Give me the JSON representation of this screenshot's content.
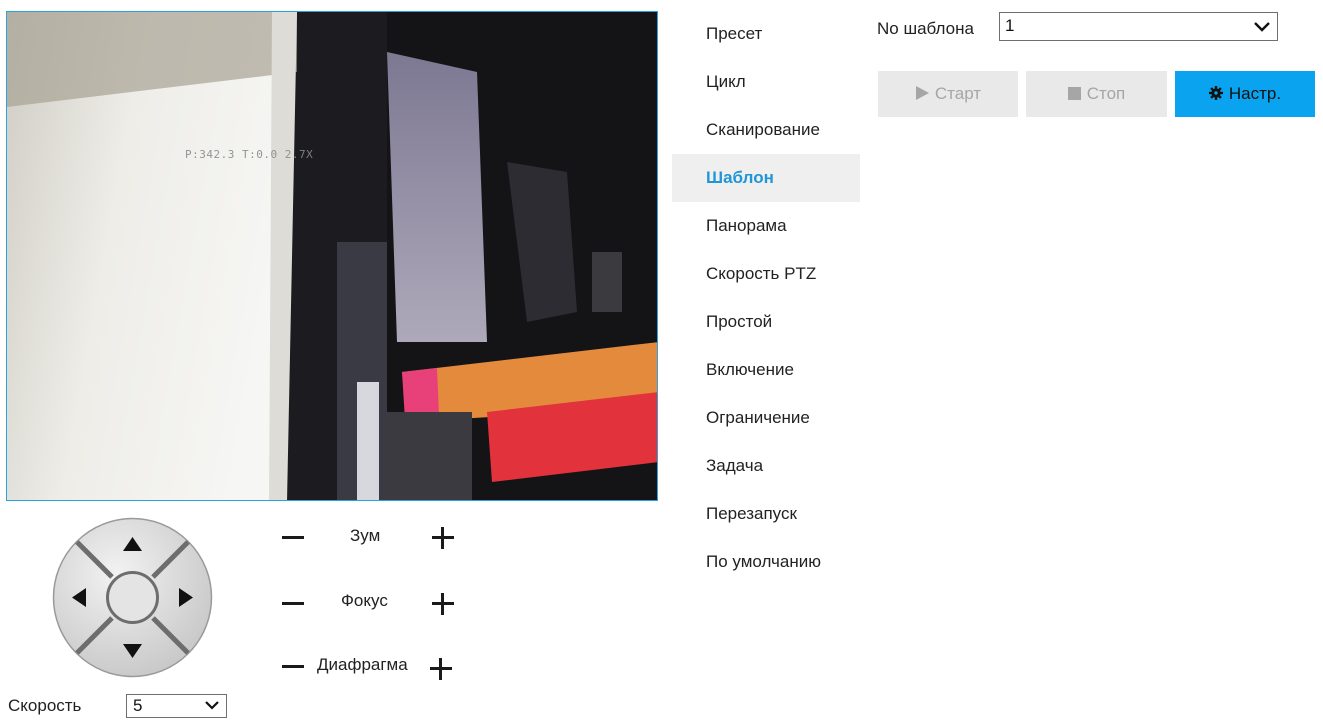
{
  "video": {
    "osd_text": "P:342.3 T:0.0 2.7X"
  },
  "ptz": {
    "zoom_label": "Зум",
    "focus_label": "Фокус",
    "iris_label": "Диафрагма",
    "speed_label": "Скорость",
    "speed_value": "5"
  },
  "menu": {
    "items": [
      {
        "label": "Пресет"
      },
      {
        "label": "Цикл"
      },
      {
        "label": "Сканирование"
      },
      {
        "label": "Шаблон"
      },
      {
        "label": "Панорама"
      },
      {
        "label": "Скорость PTZ"
      },
      {
        "label": "Простой"
      },
      {
        "label": "Включение"
      },
      {
        "label": "Ограничение"
      },
      {
        "label": "Задача"
      },
      {
        "label": "Перезапуск"
      },
      {
        "label": "По умолчанию"
      }
    ],
    "active": "Шаблон"
  },
  "template": {
    "label": "No шаблона",
    "value": "1",
    "start_label": "Старт",
    "stop_label": "Стоп",
    "settings_label": "Настр."
  },
  "colors": {
    "accent": "#0aa3ef",
    "active_text": "#2196d6",
    "disabled_bg": "#e9e9e9",
    "disabled_text": "#a6a6a6"
  }
}
